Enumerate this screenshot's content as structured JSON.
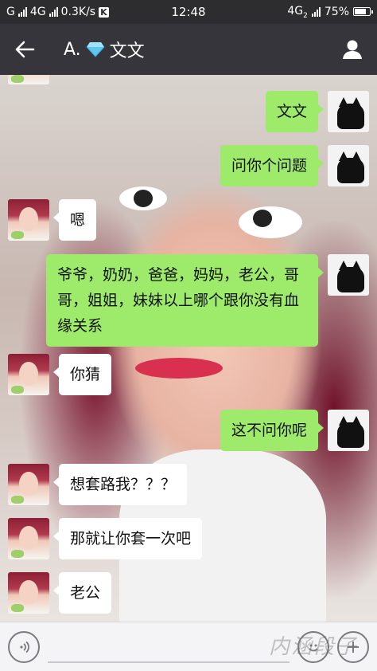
{
  "status_bar": {
    "carrier1": "G",
    "carrier2": "4G",
    "speed": "0.3K/s",
    "k_badge": "K",
    "time": "12:48",
    "network": "4G",
    "sim": "2",
    "battery": "75%",
    "battery_level": 0.75
  },
  "header": {
    "back_icon": "back-arrow-icon",
    "title_prefix": "A.",
    "title_icon": "diamond-icon",
    "title_name": "文文",
    "profile_icon": "person-icon"
  },
  "messages": [
    {
      "side": "right",
      "text": "文文"
    },
    {
      "side": "right",
      "text": "问你个问题"
    },
    {
      "side": "left",
      "text": "嗯"
    },
    {
      "side": "right",
      "text": "爷爷，奶奶，爸爸，妈妈，老公，哥哥，姐姐，妹妹以上哪个跟你没有血缘关系"
    },
    {
      "side": "left",
      "text": "你猜"
    },
    {
      "side": "right",
      "text": "这不问你呢"
    },
    {
      "side": "left",
      "text": "想套路我？？？"
    },
    {
      "side": "left",
      "text": "那就让你套一次吧"
    },
    {
      "side": "left",
      "text": "老公"
    }
  ],
  "input_bar": {
    "voice_icon": "voice-icon",
    "emoji_icon": "emoji-icon",
    "plus_icon": "plus-icon",
    "watermark": "内涵段子"
  },
  "colors": {
    "sent_bubble": "#9eea6a",
    "received_bubble": "#ffffff",
    "nav_bg": "#35353b",
    "status_bg": "#2d2d2f"
  }
}
